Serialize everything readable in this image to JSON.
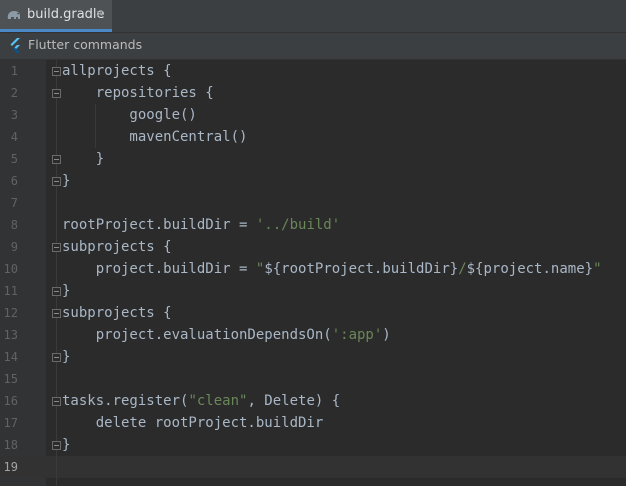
{
  "tab": {
    "label": "build.gradle",
    "close": "×",
    "icon": "gradle-elephant-icon",
    "accent": "#4a88c7"
  },
  "commands_bar": {
    "label": "Flutter commands",
    "icon": "flutter-icon"
  },
  "editor": {
    "current_line": "19",
    "lines": [
      {
        "num": "1",
        "segs": [
          {
            "t": "allprojects {"
          }
        ]
      },
      {
        "num": "2",
        "segs": [
          {
            "t": "    repositories {"
          }
        ]
      },
      {
        "num": "3",
        "segs": [
          {
            "t": "        google()"
          }
        ]
      },
      {
        "num": "4",
        "segs": [
          {
            "t": "        mavenCentral()"
          }
        ]
      },
      {
        "num": "5",
        "segs": [
          {
            "t": "    }"
          }
        ]
      },
      {
        "num": "6",
        "segs": [
          {
            "t": "}"
          }
        ]
      },
      {
        "num": "7",
        "segs": []
      },
      {
        "num": "8",
        "segs": [
          {
            "t": "rootProject.buildDir = "
          },
          {
            "t": "'../build'",
            "s": true
          }
        ]
      },
      {
        "num": "9",
        "segs": [
          {
            "t": "subprojects {"
          }
        ]
      },
      {
        "num": "10",
        "segs": [
          {
            "t": "    project.buildDir = "
          },
          {
            "t": "\"",
            "s": true
          },
          {
            "t": "${rootProject.buildDir}"
          },
          {
            "t": "/",
            "s": true
          },
          {
            "t": "${project.name}"
          },
          {
            "t": "\"",
            "s": true
          }
        ]
      },
      {
        "num": "11",
        "segs": [
          {
            "t": "}"
          }
        ]
      },
      {
        "num": "12",
        "segs": [
          {
            "t": "subprojects {"
          }
        ]
      },
      {
        "num": "13",
        "segs": [
          {
            "t": "    project.evaluationDependsOn("
          },
          {
            "t": "':app'",
            "s": true
          },
          {
            "t": ")"
          }
        ]
      },
      {
        "num": "14",
        "segs": [
          {
            "t": "}"
          }
        ]
      },
      {
        "num": "15",
        "segs": []
      },
      {
        "num": "16",
        "segs": [
          {
            "t": "tasks.register("
          },
          {
            "t": "\"clean\"",
            "s": true
          },
          {
            "t": ", Delete) {"
          }
        ]
      },
      {
        "num": "17",
        "segs": [
          {
            "t": "    delete rootProject.buildDir"
          }
        ]
      },
      {
        "num": "18",
        "segs": [
          {
            "t": "}"
          }
        ]
      },
      {
        "num": "19",
        "segs": []
      }
    ]
  },
  "colors": {
    "background": "#2b2b2b",
    "code": "#a9b7c6",
    "string": "#6a8759",
    "line_number": "#606366"
  }
}
